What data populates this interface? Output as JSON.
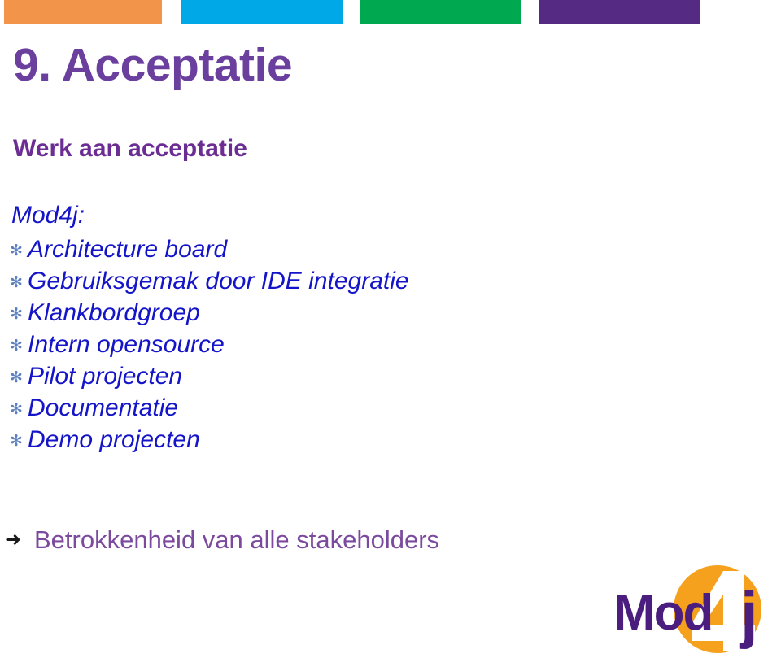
{
  "slide": {
    "title": "9. Acceptatie",
    "subtitle": "Werk aan acceptatie",
    "intro": "Mod4j:",
    "bullets": [
      {
        "marker": "✻",
        "text": "Architecture board"
      },
      {
        "marker": "✻",
        "text": "Gebruiksgemak door IDE integratie"
      },
      {
        "marker": "✻",
        "text": "Klankbordgroep"
      },
      {
        "marker": "✻",
        "text": "Intern opensource"
      },
      {
        "marker": "✻",
        "text": "Pilot projecten"
      },
      {
        "marker": "✻",
        "text": "Documentatie"
      },
      {
        "marker": "✻",
        "text": "Demo projecten"
      }
    ],
    "conclusion": {
      "marker": "➜",
      "text": "Betrokkenheid van alle stakeholders"
    }
  },
  "decor": {
    "top_bars": [
      {
        "name": "orange",
        "color": "#f2944a"
      },
      {
        "name": "blue",
        "color": "#00a8e8"
      },
      {
        "name": "green",
        "color": "#00a84f"
      },
      {
        "name": "purple",
        "color": "#552a82"
      }
    ]
  },
  "logo": {
    "word_left": "Mod",
    "word_digit": "4",
    "word_right": "j",
    "purple": "#4b1d7e",
    "orange": "#f5a11e",
    "white": "#ffffff"
  },
  "colors": {
    "title_purple": "#6b3f9e",
    "subtitle_purple": "#6b2d93",
    "body_blue": "#1414c8",
    "star_blue": "#5b7fbf",
    "conclusion_purple": "#7b4a9e"
  }
}
